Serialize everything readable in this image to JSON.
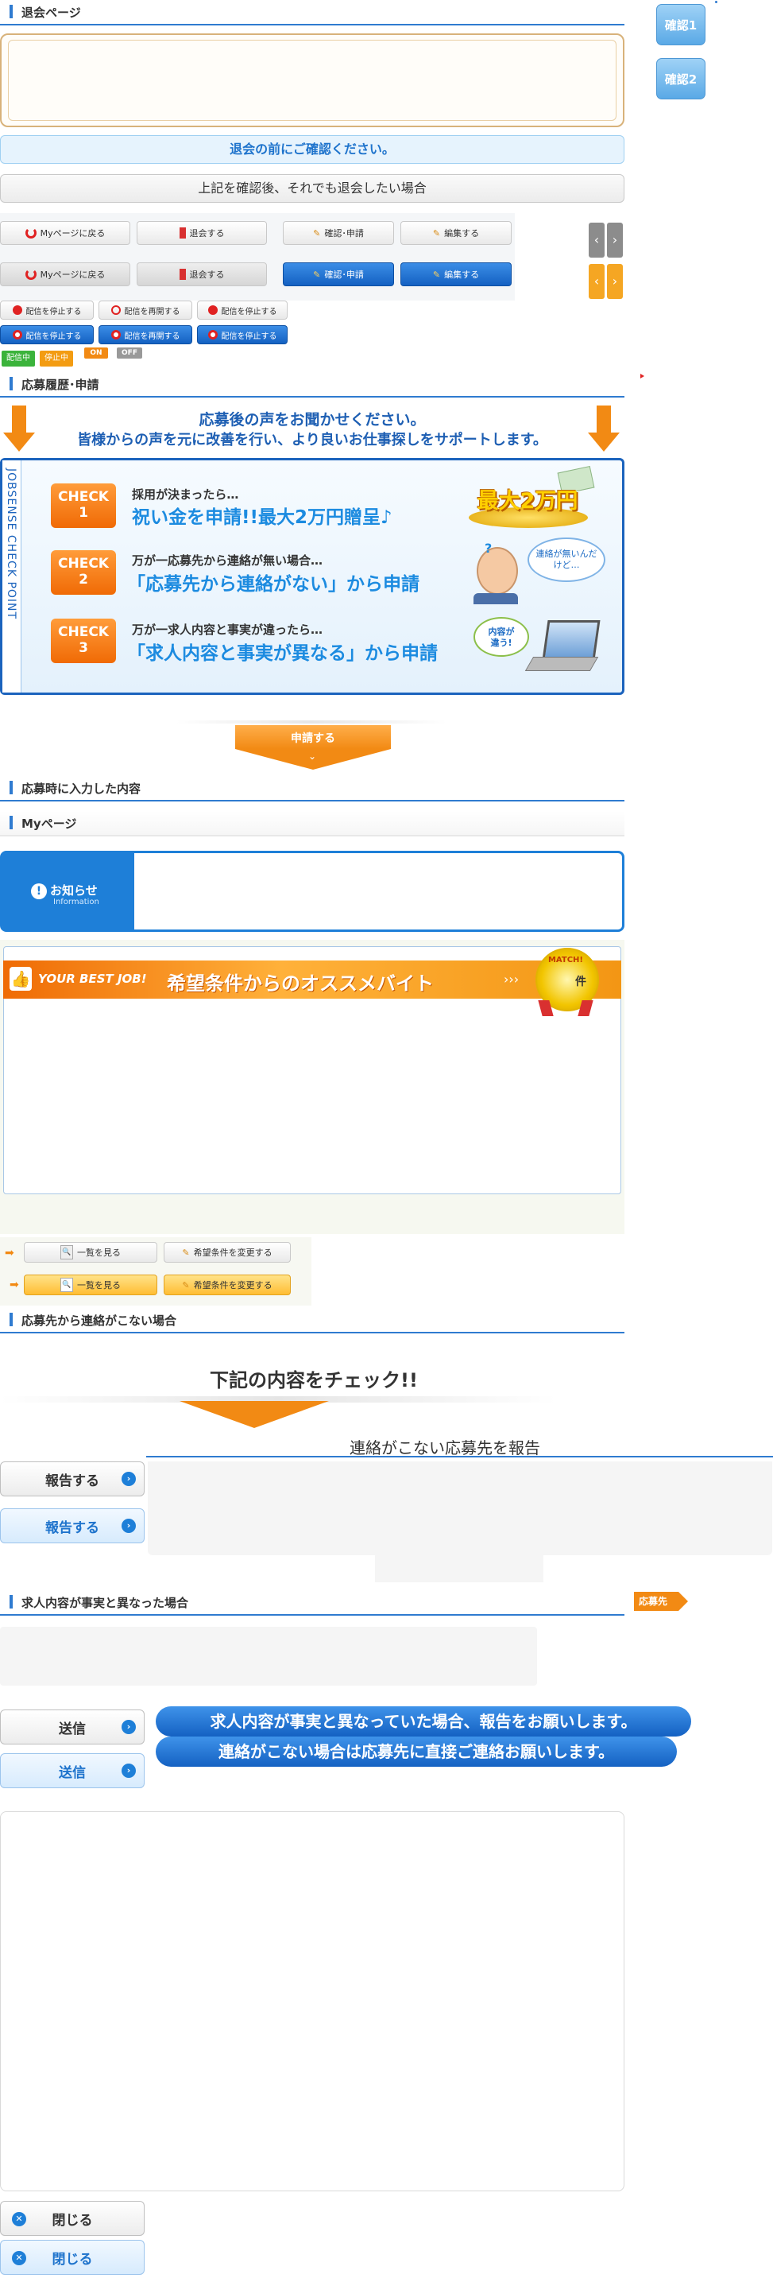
{
  "withdraw": {
    "title": "退会ページ",
    "confirm_notice": "退会の前にご確認ください。",
    "confirm_after": "上記を確認後、それでも退会したい場合"
  },
  "side_buttons": {
    "confirm1": "確認1",
    "confirm2": "確認2"
  },
  "button_row": {
    "mypage": "Myページに戻る",
    "withdraw": "退会する",
    "confirm_apply": "確認･申請",
    "edit": "編集する"
  },
  "delivery": {
    "stop": "配信を停止する",
    "resume": "配信を再開する",
    "badge_on": "配信中",
    "badge_stop": "停止中",
    "toggle_on": "ON",
    "toggle_off": "OFF"
  },
  "history": {
    "title": "応募履歴･申請",
    "banner_line1": "応募後の声をお聞かせください。",
    "banner_line2": "皆様からの声を元に改善を行い、より良いお仕事探しをサポートします。",
    "side_label": "JOBSENSE CHECK POINT",
    "checks": [
      {
        "badge_top": "CHECK",
        "badge_num": "1",
        "small": "採用が決まったら…",
        "big": "祝い金を申請!!最大2万円贈呈♪"
      },
      {
        "badge_top": "CHECK",
        "badge_num": "2",
        "small": "万が一応募先から連絡が無い場合…",
        "big": "「応募先から連絡がない」から申請"
      },
      {
        "badge_top": "CHECK",
        "badge_num": "3",
        "small": "万が一求人内容と事実が違ったら…",
        "big": "「求人内容と事実が異なる」から申請"
      }
    ],
    "max_prize": "最大2万円",
    "bubble_no_contact": "連絡が無いんだけど…",
    "bubble_diff": "内容が違う!",
    "apply_button": "申請する"
  },
  "applied_content": {
    "title": "応募時に入力した内容"
  },
  "mypage": {
    "title": "Myページ",
    "info_label": "お知らせ",
    "info_sub": "Information"
  },
  "recommend": {
    "best_job": "YOUR BEST JOB!",
    "heading": "希望条件からのオススメバイト",
    "match_label": "MATCH!",
    "match_unit": "件",
    "list_button": "一覧を見る",
    "change_button": "希望条件を変更する"
  },
  "no_contact": {
    "title": "応募先から連絡がこない場合",
    "check_heading": "下記の内容をチェック!!",
    "report_title": "連絡がこない応募先を報告",
    "report_button": "報告する"
  },
  "diff": {
    "title": "求人内容が事実と異なった場合",
    "tag": "応募先",
    "send_button": "送信",
    "msg1": "求人内容が事実と異なっていた場合、報告をお願いします。",
    "msg2": "連絡がこない場合は応募先に直接ご連絡お願いします。"
  },
  "close_button": "閉じる",
  "colors": {
    "accent": "#2f7bd0",
    "orange": "#f28a14",
    "light_blue": "#e6f3fd"
  }
}
